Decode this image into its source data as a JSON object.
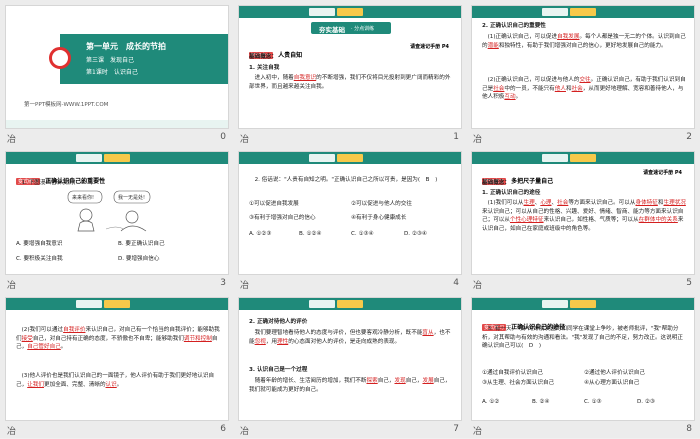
{
  "slides": [
    {
      "index": "0",
      "title1": "第一单元　成长的节拍",
      "title2": "第三课　发现自己",
      "title3": "第1课时　认识自己",
      "website": "第一PPT模板网-WWW.1PPT.COM"
    },
    {
      "index": "1",
      "banner": "夯实基础",
      "banner_sub": "· 分点训练",
      "tag": "知识点一",
      "sec": "人贵自知",
      "ref": "请查速记手册 P4",
      "base": "基础概念：",
      "item1": "1. 关注自我",
      "line1": "进入初中，随着",
      "line1_red": "自我意识",
      "line1b": "的不断增强，我们不仅将目光投射到更广阔而精彩的外部世界，而且越来越关注自我。"
    },
    {
      "index": "2",
      "head": "2. 正确认识自己的重要性",
      "p1a": "(1)正确认识自己，可以促进",
      "p1r1": "自我发展",
      "p1b": "。每个人都是独一无二的个体。认识到自己的",
      "p1r2": "潜能",
      "p1c": "和独特性，有助于我们增强对自己的信心，更好地发展自己的能力。",
      "p2a": "(2)正确认识自己，可以促进与他人的",
      "p2r1": "交往",
      "p2b": "。正确认识自己，有助于我们认识到自己是",
      "p2r2": "社会",
      "p2c": "中的一员，不能只有",
      "p2r3": "他人",
      "p2d": "和",
      "p2r4": "社会",
      "p2e": "，从而更好地理解、宽容和善待他人，与他人积极",
      "p2r5": "互动",
      "p2f": "。"
    },
    {
      "index": "3",
      "tag": "变式练习",
      "q": "正确认识自己的重要性",
      "q1": "1. 下图漫画告诉我们(　B　)",
      "bubble1": "来来看你!",
      "bubble2": "我一无是处!",
      "optA": "A. 要增强自我意识",
      "optB": "B. 要正确认识自己",
      "optC": "C. 要积极关注自我",
      "optD": "D. 要增强自信心"
    },
    {
      "index": "4",
      "q2": "2. 俗话说：\"人贵有自知之明。\"正确认识自己之所以可贵，是因为(　B　)",
      "o1": "①可以促进自我发展",
      "o2": "②可以促进与他人的交往",
      "o3": "③有利于增强对自己的信心",
      "o4": "④有利于身心健康成长",
      "A": "A. ①②③",
      "B": "B. ①②④",
      "C": "C. ①③④",
      "D": "D. ②③④"
    },
    {
      "index": "5",
      "tag": "知识点二",
      "sec": "多把尺子量自己",
      "ref": "请查速记手册 P4",
      "base": "基础概念：",
      "item": "1. 正确认识自己的途径",
      "l1": "(1)我们可以从",
      "r1": "生理",
      "l1b": "、",
      "r2": "心理",
      "l1c": "、",
      "r3": "社会",
      "l1d": "等方面来认识自己。可以从",
      "r4": "身体特征",
      "l1e": "和",
      "r5": "生理状况",
      "l1f": "来认识自己；可以从自己的性格、兴趣、爱好、情绪、智商、能力等方面来认识自己；可以从",
      "r6": "个性心理特征",
      "l1g": "来认识自己，如性格、气质等；可以从",
      "r7": "在群体中的关系",
      "l1h": "来认识自己，如自己在家庭或班级中的角色等。"
    },
    {
      "index": "6",
      "p2a": "(2)我们可以通过",
      "r1": "自我评价",
      "p2b": "来认识自己，对自己有一个恰当的自我评价；能够助我们",
      "r2": "接受",
      "p2c": "自己，对自己持有正确的态度，不骄傲也不自卑；能够助我们",
      "r3": "调节和控制",
      "p2d": "自己，",
      "r4": "自己管好自己",
      "p2e": "。",
      "p3a": "(3)他人评价也是我们认识自己的一面镜子，他人评价有助于我们更好地认识自己，",
      "r5": "让我们",
      "p3b": "更加全面、完整、清晰的",
      "r6": "认识",
      "p3c": "。"
    },
    {
      "index": "7",
      "h2": "2. 正确对待他人的评价",
      "t1": "我们要理智地看待他人的态度与评价，但也要客观冷静分析，既不能",
      "r1": "盲从",
      "t1b": "，也不能",
      "r2": "忽视",
      "t1c": "，用",
      "r3": "理性",
      "t1d": "的心态面对他人的评价，是走向成熟的表现。",
      "h3": "3. 认识自己是一个过程",
      "t2": "随着年龄的增长、生活阅历的增加，我们不断",
      "r4": "探索",
      "t2b": "自己，",
      "r5": "发现",
      "t2c": "自己，",
      "r6": "发展",
      "t2d": "自己，我们就可能成为更好的自己。"
    },
    {
      "index": "8",
      "tag": "变式练习",
      "q": "正确认识自己的途径",
      "q3": "3. 有一天，\"我\"的好朋友因为和同学在课堂上争吵，被老师批评，\"我\"帮助分析，对其帮助与有效的沟通和看法。\"我\"发现了自己的不足，努力改正。这说明正确认识自己可以(　D　)",
      "o1": "①通过自我评价认识自己",
      "o2": "②通过他人评价认识自己",
      "o3": "③从生理、社会方面认识自己",
      "o4": "④从心理方面认识自己",
      "A": "A. ①②",
      "B": "B. ②④",
      "C": "C. ①③",
      "D": "D. ②③"
    }
  ],
  "footer_left": "冶"
}
